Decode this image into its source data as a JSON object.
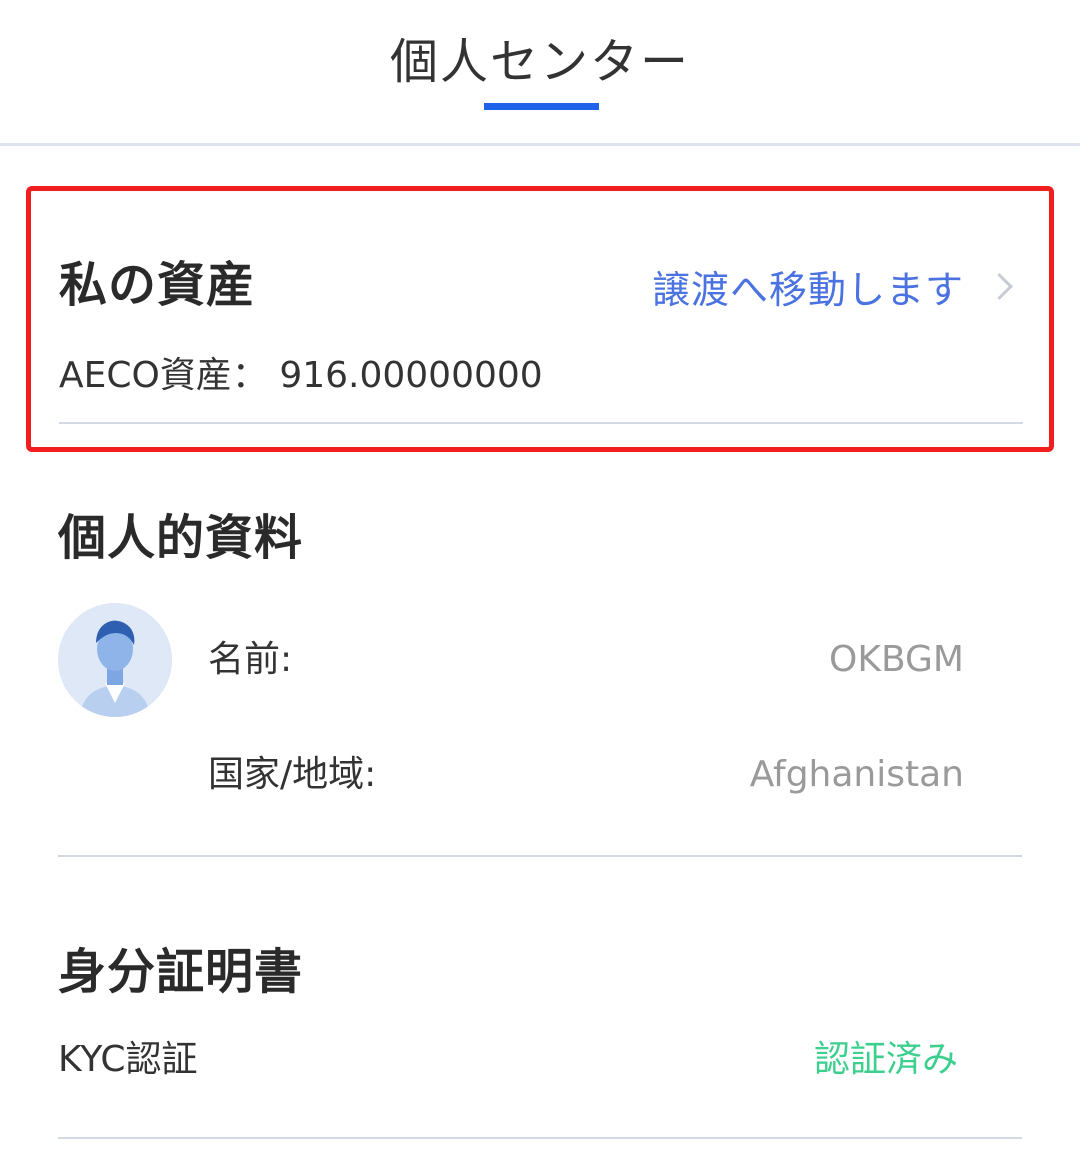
{
  "header": {
    "title": "個人センター"
  },
  "assets": {
    "title": "私の資産",
    "transfer_label": "譲渡へ移動します",
    "balance_label": "AECO資産：",
    "balance_value": "916.00000000"
  },
  "profile": {
    "title": "個人的資料",
    "avatar_icon": "user-avatar-icon",
    "name_label": "名前:",
    "name_value": "OKBGM",
    "country_label": "国家/地域:",
    "country_value": "Afghanistan"
  },
  "identity": {
    "title": "身分証明書",
    "kyc_label": "KYC認証",
    "kyc_status": "認証済み"
  },
  "colors": {
    "accent": "#1e63e9",
    "link": "#4a72e0",
    "highlight_border": "#f01e1e",
    "verified": "#3ccf8e"
  }
}
